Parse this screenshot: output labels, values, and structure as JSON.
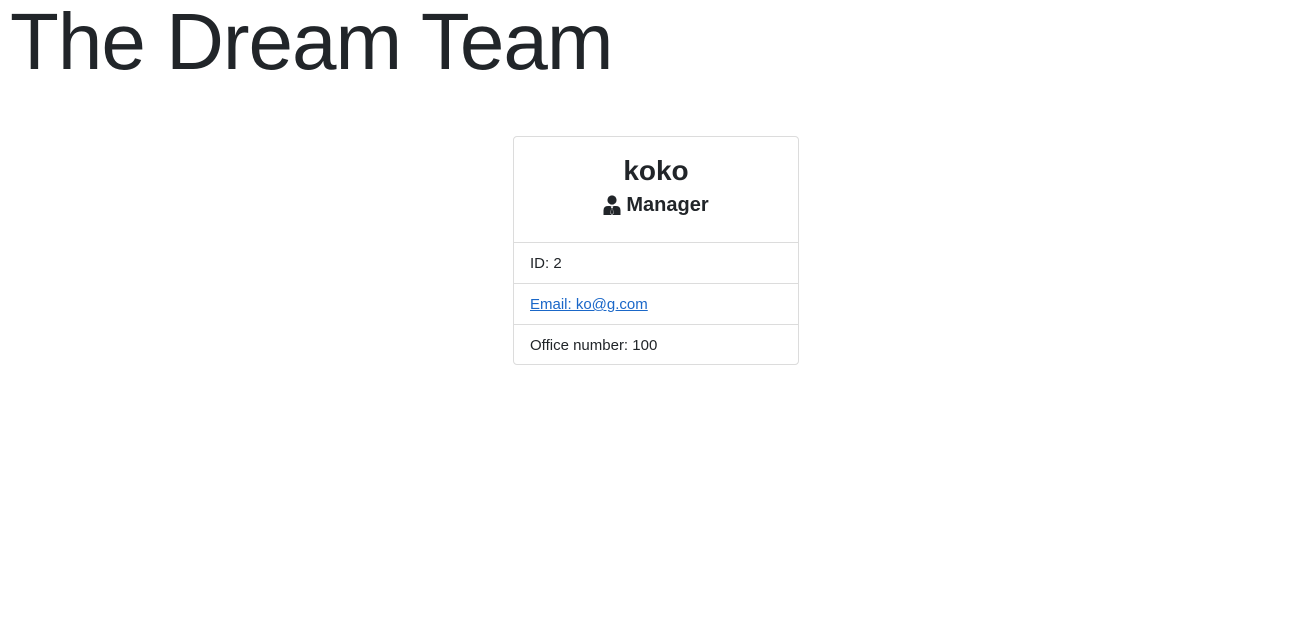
{
  "page": {
    "title": "The Dream Team"
  },
  "cards": [
    {
      "name": "koko",
      "role": "Manager",
      "role_icon": "user-tie-icon",
      "id_text": "ID: 2",
      "email_text": "Email: ko@g.com",
      "office_text": "Office number: 100"
    }
  ],
  "colors": {
    "text": "#212529",
    "link": "#1a67c8",
    "border": "#dcdcdc",
    "background": "#ffffff"
  }
}
